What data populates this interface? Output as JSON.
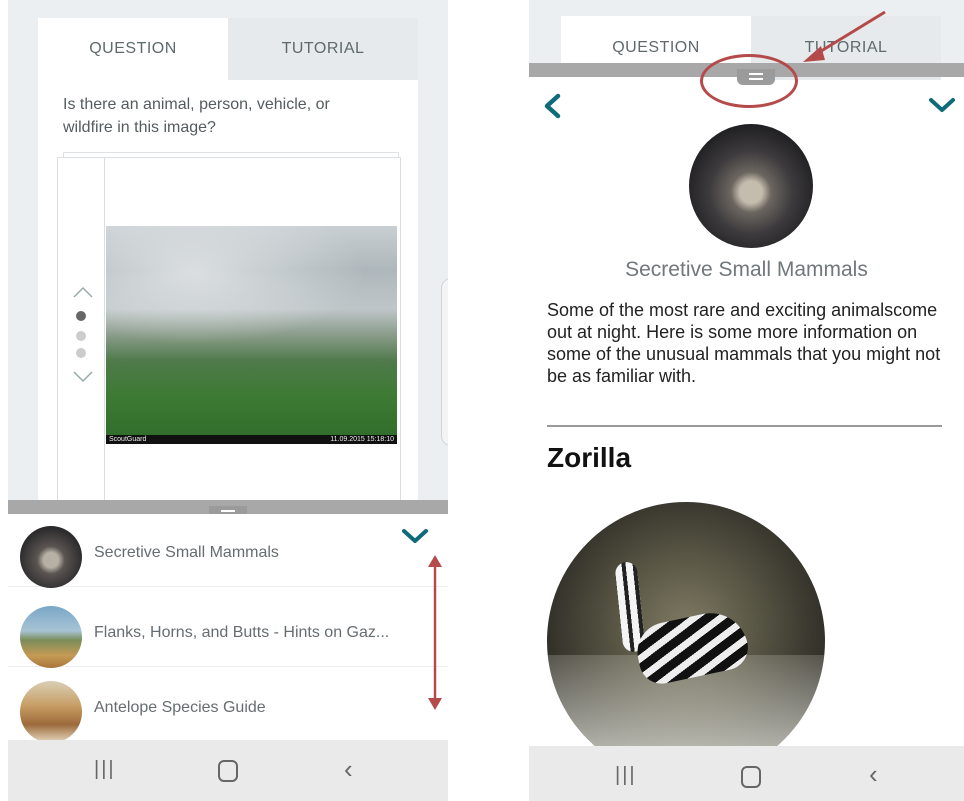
{
  "colors": {
    "accent_teal": "#0e6b7a",
    "annotation_red": "#b54a4a",
    "sheet_bar": "#a8a8a8"
  },
  "left_screen": {
    "tabs": [
      {
        "label": "QUESTION"
      },
      {
        "label": "TUTORIAL"
      }
    ],
    "question": "Is there an animal, person, vehicle, or wildfire in this image?",
    "image": {
      "camera_brand": "ScoutGuard",
      "timestamp": "11.09.2015 15:18:10"
    },
    "pagination": {
      "current": 1,
      "total": 3
    },
    "field_guide": {
      "items": [
        {
          "label": "Secretive Small Mammals"
        },
        {
          "label": "Flanks, Horns, and Butts - Hints on Gaz..."
        },
        {
          "label": "Antelope Species Guide"
        }
      ]
    }
  },
  "right_screen": {
    "tabs": [
      {
        "label": "QUESTION"
      },
      {
        "label": "TUTORIAL"
      }
    ],
    "article": {
      "title": "Secretive Small Mammals",
      "body": "Some of the most rare and exciting animalscome out at night. Here is some more information on some of the unusual mammals that you might not be as familiar with.",
      "section_heading": "Zorilla"
    }
  },
  "icons": {
    "collapse": "chevron-down-icon",
    "back": "chevron-left-icon",
    "nav_recent": "recent-apps-icon",
    "nav_home": "home-icon",
    "nav_back": "back-icon"
  }
}
